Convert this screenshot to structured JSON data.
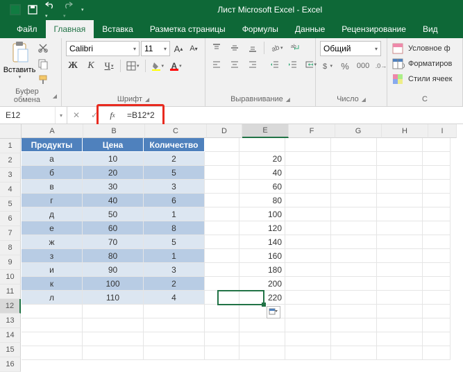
{
  "window": {
    "title": "Лист Microsoft Excel  -  Excel"
  },
  "tabs": {
    "file": "Файл",
    "home": "Главная",
    "insert": "Вставка",
    "layout": "Разметка страницы",
    "formulas": "Формулы",
    "data": "Данные",
    "review": "Рецензирование",
    "view": "Вид"
  },
  "ribbon": {
    "paste": "Вставить",
    "clipboard_group": "Буфер обмена",
    "font_name": "Calibri",
    "font_size": "11",
    "font_group": "Шрифт",
    "bold": "Ж",
    "italic": "К",
    "underline": "Ч",
    "align_group": "Выравнивание",
    "number_format": "Общий",
    "number_group": "Число",
    "cond_fmt": "Условное ф",
    "fmt_table": "Форматиров",
    "cell_styles": "Стили ячеек",
    "styles_group": "С"
  },
  "formula_bar": {
    "name_box": "E12",
    "formula": "=B12*2"
  },
  "columns": [
    "A",
    "B",
    "C",
    "D",
    "E",
    "F",
    "G",
    "H",
    "I"
  ],
  "colw": {
    "A": "wA",
    "B": "wB",
    "C": "wC",
    "D": "wD",
    "E": "wE",
    "F": "wF",
    "G": "wG",
    "H": "wH",
    "I": "wI"
  },
  "headers": {
    "A": "Продукты",
    "B": "Цена",
    "C": "Количество"
  },
  "table": [
    {
      "A": "а",
      "B": "10",
      "C": "2",
      "E": "20"
    },
    {
      "A": "б",
      "B": "20",
      "C": "5",
      "E": "40"
    },
    {
      "A": "в",
      "B": "30",
      "C": "3",
      "E": "60"
    },
    {
      "A": "г",
      "B": "40",
      "C": "6",
      "E": "80"
    },
    {
      "A": "д",
      "B": "50",
      "C": "1",
      "E": "100"
    },
    {
      "A": "е",
      "B": "60",
      "C": "8",
      "E": "120"
    },
    {
      "A": "ж",
      "B": "70",
      "C": "5",
      "E": "140"
    },
    {
      "A": "з",
      "B": "80",
      "C": "1",
      "E": "160"
    },
    {
      "A": "и",
      "B": "90",
      "C": "3",
      "E": "180"
    },
    {
      "A": "к",
      "B": "100",
      "C": "2",
      "E": "200"
    },
    {
      "A": "л",
      "B": "110",
      "C": "4",
      "E": "220"
    }
  ],
  "total_rows": 16,
  "selected": {
    "row": 12,
    "col": "E"
  }
}
